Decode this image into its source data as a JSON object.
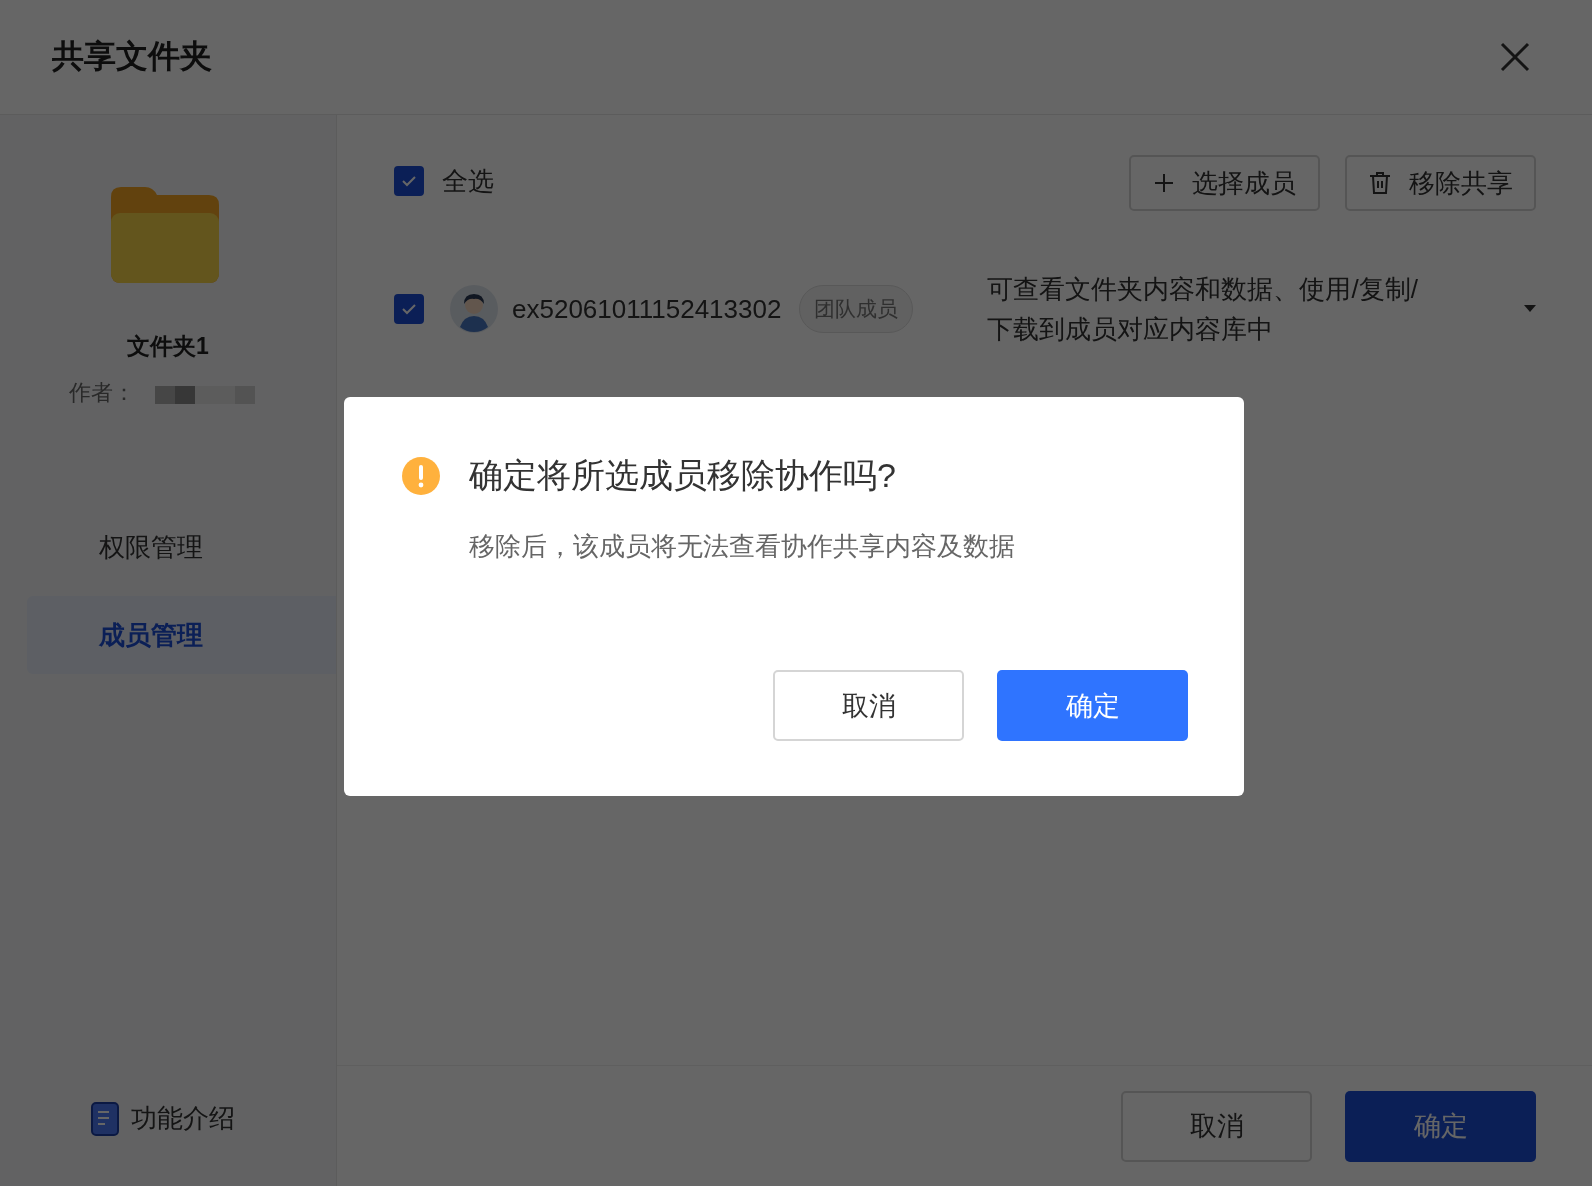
{
  "dialog_title": "共享文件夹",
  "folder": {
    "name": "文件夹1",
    "author_label": "作者："
  },
  "nav": [
    {
      "label": "权限管理",
      "selected": false
    },
    {
      "label": "成员管理",
      "selected": true
    }
  ],
  "help": {
    "label": "功能介绍"
  },
  "select_all": {
    "label": "全选",
    "checked": true
  },
  "toolbar_buttons": [
    {
      "label": "选择成员",
      "kind": "add"
    },
    {
      "label": "移除共享",
      "kind": "delete"
    }
  ],
  "members": [
    {
      "id": "ex52061011152413302",
      "tag": "团队成员",
      "permission": "可查看文件夹内容和数据、使用/复制/下载到成员对应内容库中",
      "checked": true
    }
  ],
  "footer_buttons": [
    {
      "label": "取消",
      "kind": "secondary"
    },
    {
      "label": "确定",
      "kind": "primary"
    }
  ],
  "confirm": {
    "title": "确定将所选成员移除协作吗?",
    "message": "移除后，该成员将无法查看协作共享内容及数据",
    "buttons": [
      {
        "label": "取消",
        "kind": "secondary"
      },
      {
        "label": "确定",
        "kind": "primary"
      }
    ]
  }
}
